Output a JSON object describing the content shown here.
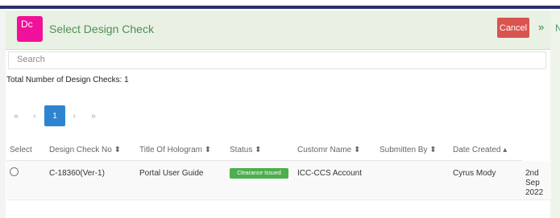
{
  "header": {
    "app_icon_text": "Dc",
    "title": "Select Design Check",
    "cancel_label": "Cancel",
    "next_glyph": "»",
    "side_letter": "N"
  },
  "search": {
    "placeholder": "Search"
  },
  "summary": {
    "total_label": "Total Number of Design Checks: 1"
  },
  "pagination": {
    "first": "«",
    "prev": "‹",
    "current": "1",
    "next": "›",
    "last": "»"
  },
  "table": {
    "headers": {
      "select": "Select",
      "design_check_no": "Design Check No ⬍",
      "title_of_hologram": "Title Of Hologram ⬍",
      "status": "Status ⬍",
      "customer_name": "Customr Name ⬍",
      "submitted_by": "Submitten By ⬍",
      "date_created": "Date Created ▴"
    },
    "rows": [
      {
        "design_check_no": "C-18360(Ver-1)",
        "title_of_hologram": "Portal User Guide",
        "status": "Clearance Issued",
        "customer_name": "ICC-CCS Account",
        "submitted_by": "Cyrus Mody",
        "date_line1": "2nd",
        "date_line2": "Sep",
        "date_line3": "2022"
      }
    ]
  },
  "colors": {
    "header_bg": "#e8f1e3",
    "title_green": "#4e8f58",
    "app_icon": "#f0119a",
    "cancel_red": "#d9534f",
    "pagination_active": "#2f84cf",
    "status_green": "#4cae4c",
    "top_stripe": "#2b2f6e"
  }
}
